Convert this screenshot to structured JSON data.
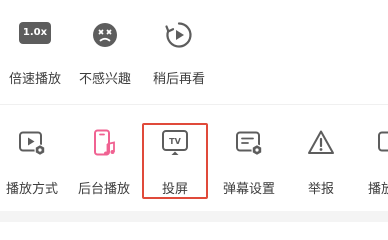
{
  "top_row": [
    {
      "label": "倍速播放",
      "badge": "1.0x",
      "icon": "speed-badge-icon"
    },
    {
      "label": "不感兴趣",
      "icon": "dislike-face-icon"
    },
    {
      "label": "稍后再看",
      "icon": "watch-later-icon"
    }
  ],
  "bottom_row": [
    {
      "label": "播放方式",
      "icon": "play-mode-icon"
    },
    {
      "label": "后台播放",
      "icon": "background-play-icon"
    },
    {
      "label": "投屏",
      "icon": "cast-tv-icon",
      "icon_text": "TV"
    },
    {
      "label": "弹幕设置",
      "icon": "danmaku-settings-icon"
    },
    {
      "label": "举报",
      "icon": "report-warning-icon"
    },
    {
      "label": "播放"
    }
  ],
  "colors": {
    "icon_gray": "#5d5d5d",
    "accent_pink": "#f06292",
    "highlight_red": "#e04a3a",
    "text": "#3d3d3d"
  }
}
